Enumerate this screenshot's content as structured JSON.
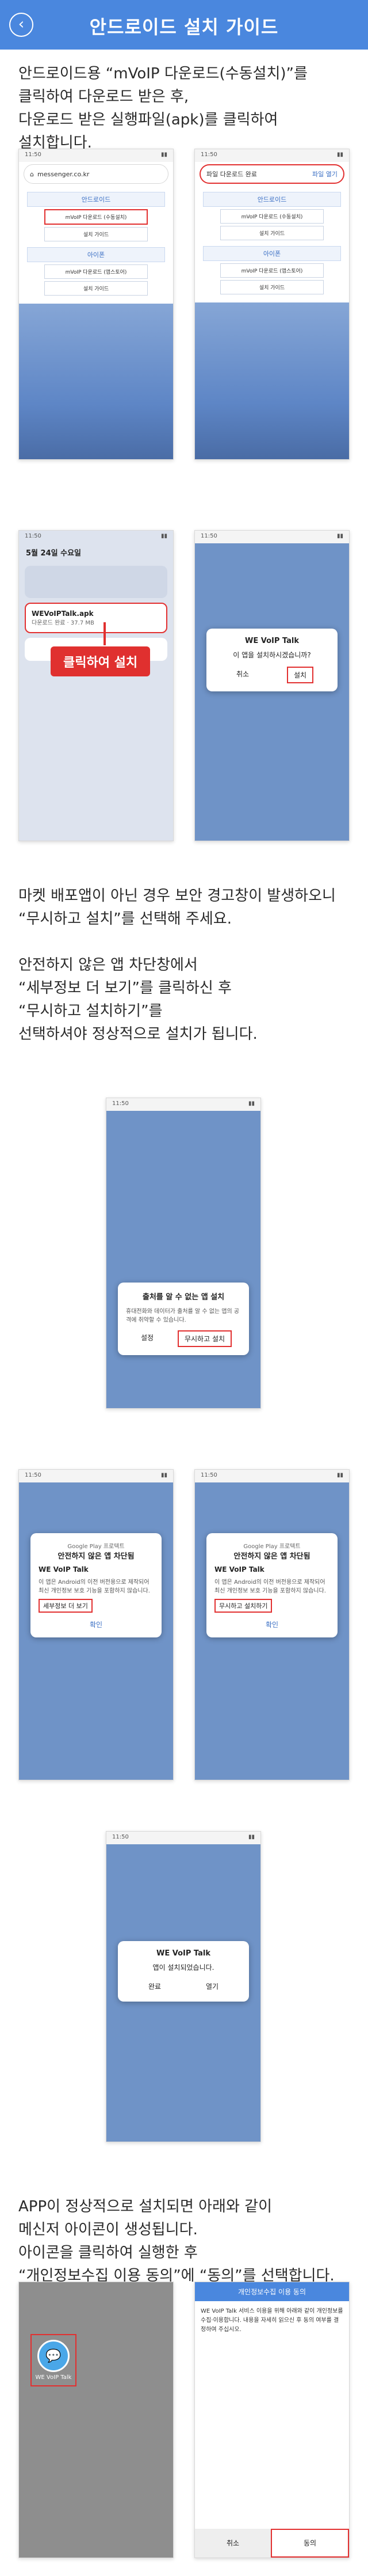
{
  "header": {
    "title": "안드로이드 설치 가이드",
    "back_icon": "‹"
  },
  "step1_text": "안드로이드용 “mVoIP 다운로드(수동설치)”를\n클릭하여 다운로드 받은 후,\n다운로드 받은 실행파일(apk)를 클릭하여\n설치합니다.",
  "step2_text": "마켓 배포앱이 아닌 경우 보안 경고창이 발생하오니\n“무시하고 설치”를 선택해 주세요.\n\n안전하지 않은 앱 차단창에서\n“세부정보 더 보기”를 클릭하신 후\n“무시하고 설치하기”를\n선택하셔야 정상적으로 설치가 됩니다.",
  "step3_text": "APP이 정상적으로 설치되면 아래와 같이\n메신저 아이콘이 생성됩니다.\n아이콘을 클릭하여 실행한 후\n“개인정보수집 이용 동의”에 “동의”를 선택합니다.",
  "browser": {
    "url": "messenger.co.kr",
    "status_time": "11:50",
    "android_section": "안드로이드",
    "android_btn1": "mVoIP 다운로드 (수동설치)",
    "android_btn2": "설치 가이드",
    "ios_section": "아이폰",
    "ios_btn1": "mVoIP 다운로드 (앱스토어)",
    "ios_btn2": "설치 가이드"
  },
  "download_bar": {
    "text": "파일 다운로드 완료",
    "action": "파일 열기"
  },
  "notification": {
    "time": "11:50",
    "date": "5월 24일 수요일",
    "app": "WEVoIPTalk.apk",
    "sub": "다운로드 완료 · 37.7 MB",
    "click_label": "클릭하여 설치"
  },
  "install_prompt": {
    "app": "WE VoIP Talk",
    "question": "이 앱을 설치하시겠습니까?",
    "cancel": "취소",
    "install": "설치"
  },
  "warning_dialog": {
    "title": "출처를 알 수 없는 앱 설치",
    "body": "휴대전화와 데이터가 출처를 알 수 없는 앱의 공격에 취약할 수 있습니다.",
    "settings": "설정",
    "ignore": "무시하고 설치"
  },
  "block_dialog": {
    "google": "Google Play 프로텍트",
    "title": "안전하지 않은 앱 차단됨",
    "app": "WE VoIP Talk",
    "body": "이 앱은 Android의 이전 버전용으로 제작되어 최신 개인정보 보호 기능을 포함하지 않습니다.",
    "more": "세부정보 더 보기",
    "ignore_install": "무시하고 설치하기",
    "ok": "확인"
  },
  "done_dialog": {
    "app": "WE VoIP Talk",
    "msg": "앱이 설치되었습니다.",
    "done": "완료",
    "open": "열기"
  },
  "icon_label": "WE VoIP Talk",
  "consent": {
    "title": "개인정보수집 이용 동의",
    "body": "WE VoIP Talk 서비스 이용을 위해 아래와 같이 개인정보를 수집·이용합니다. 내용을 자세히 읽으신 후 동의 여부를 결정하여 주십시오.",
    "cancel": "취소",
    "agree": "동의"
  },
  "colors": {
    "accent": "#4a87de",
    "highlight": "#e23030"
  }
}
